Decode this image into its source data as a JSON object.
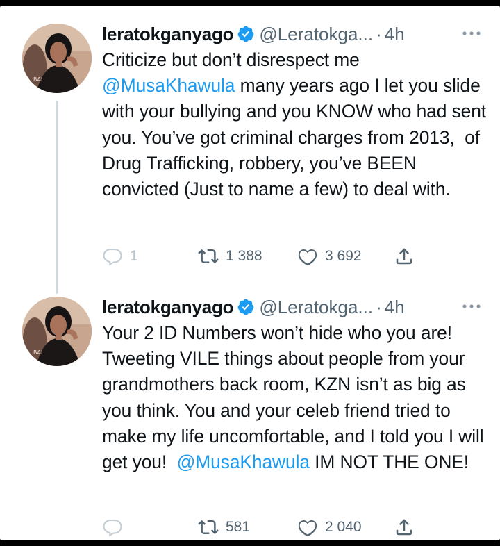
{
  "tweets": [
    {
      "author": {
        "display_name": "leratokganyago",
        "handle": "@Leratokga...",
        "verified": true
      },
      "time": "4h",
      "text_parts": {
        "p1": "Criticize but don’t disrespect me\n",
        "m1": "@MusaKhawula",
        "p2": " many years ago I let you slide with your bullying and you KNOW who had sent you. You’ve got criminal charges from 2013,  of Drug Trafficking, robbery, you’ve BEEN convicted (Just to name a few) to deal with."
      },
      "stats": {
        "replies": "1",
        "retweets": "1 388",
        "likes": "3 692"
      }
    },
    {
      "author": {
        "display_name": "leratokganyago",
        "handle": "@Leratokga...",
        "verified": true
      },
      "time": "4h",
      "text_parts": {
        "p1": "Your 2 ID Numbers won’t hide who you are! Tweeting VILE things about people from your grandmothers back room, KZN isn’t as big as you think. You and your celeb friend tried to make my life uncomfortable, and I told you I will get you!  ",
        "m1": "@MusaKhawula",
        "p2": " IM NOT THE ONE!"
      },
      "stats": {
        "replies": "",
        "retweets": "581",
        "likes": "2 040"
      }
    }
  ],
  "colors": {
    "text": "#0f1419",
    "secondary": "#536471",
    "link": "#1d9bf0",
    "verified": "#1d9bf0"
  },
  "icons": [
    "verified-badge-icon",
    "more-icon",
    "reply-icon",
    "retweet-icon",
    "like-icon",
    "share-icon"
  ]
}
